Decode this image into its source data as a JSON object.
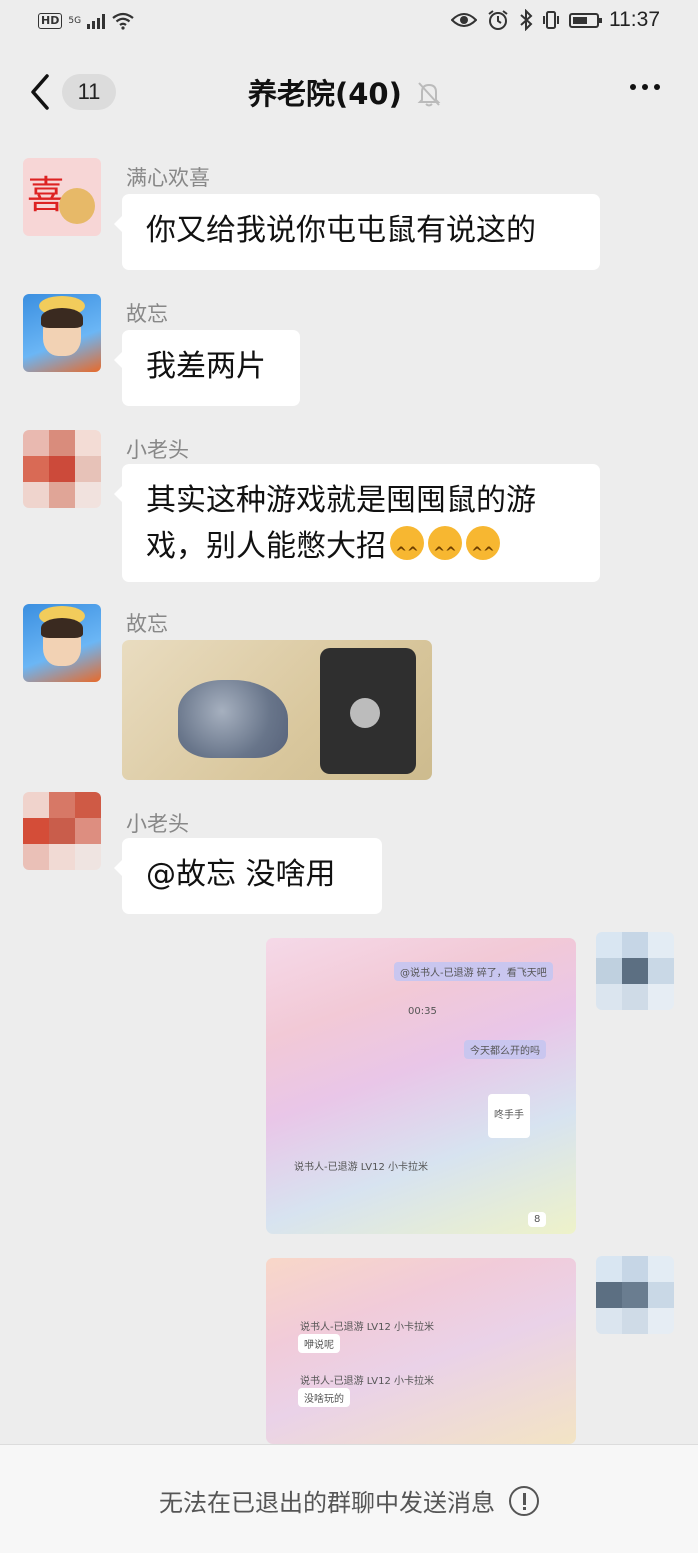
{
  "status_bar": {
    "hd": "HD",
    "network": "5G",
    "time": "11:37"
  },
  "nav": {
    "back_count": "11",
    "title": "养老院(40)"
  },
  "messages": [
    {
      "sender": "满心欢喜",
      "text": "你又给我说你屯屯鼠有说这的"
    },
    {
      "sender": "故忘",
      "text": "我差两片"
    },
    {
      "sender": "小老头",
      "text": "其实这种游戏就是囤囤鼠的游戏，别人能憋大招"
    },
    {
      "sender": "故忘"
    },
    {
      "sender": "小老头",
      "text": "@故忘  没啥用"
    }
  ],
  "screenshot1": {
    "chips": [
      "@说书人-已退游 碎了，看飞天吧",
      "00:35",
      "今天都么开的吗",
      "咚手手",
      "说书人-已退游 LV12 小卡拉米",
      "8"
    ]
  },
  "screenshot2": {
    "chips": [
      "说书人-已退游 LV12 小卡拉米",
      "咿说呢",
      "说书人-已退游 LV12 小卡拉米",
      "没啥玩的"
    ]
  },
  "footer": {
    "text": "无法在已退出的群聊中发送消息"
  },
  "colors": {
    "background": "#ededed",
    "bubble": "#ffffff",
    "sender": "#888888"
  },
  "icons": [
    "back-icon",
    "mute-bell-icon",
    "more-icon",
    "info-icon",
    "wifi-icon",
    "eye-icon",
    "alarm-icon",
    "bluetooth-icon",
    "battery-icon"
  ]
}
